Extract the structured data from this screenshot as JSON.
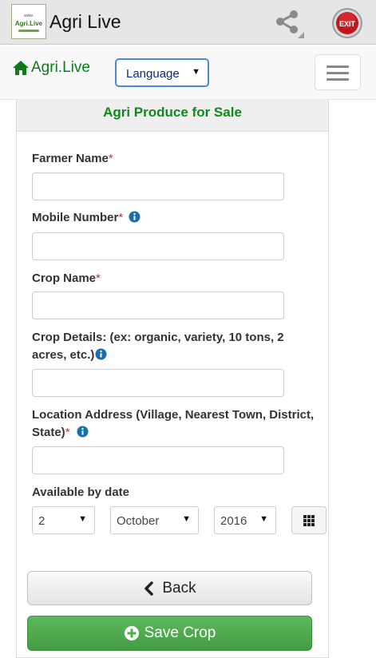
{
  "appbar": {
    "logo_top": "www.",
    "logo_text": "Agri.Live",
    "title": "Agri Live",
    "share_icon": "share-icon",
    "exit_label": "EXIT"
  },
  "navbar": {
    "brand": "Agri.Live",
    "home_icon": "home-icon",
    "language_select": "Language",
    "menu_icon": "hamburger-menu-icon"
  },
  "form": {
    "title": "Agri Produce for Sale",
    "farmer_name": {
      "label": "Farmer Name",
      "required": "*",
      "value": ""
    },
    "mobile_number": {
      "label": "Mobile Number",
      "required": "*",
      "value": ""
    },
    "crop_name": {
      "label": "Crop Name",
      "required": "*",
      "value": ""
    },
    "crop_details": {
      "label_line1": "Crop Details: (ex: organic, variety, 10 tons, 2",
      "label_line2": "acres, etc.)",
      "value": ""
    },
    "location": {
      "label_line1": "Location Address (Village, Nearest Town, District,",
      "label_line2": "State)",
      "required": "*",
      "value": ""
    },
    "available_by": {
      "label": "Available by date",
      "day": "2",
      "month": "October",
      "year": "2016"
    },
    "back_label": "Back",
    "save_label": "Save Crop"
  },
  "colors": {
    "brand_green": "#0d8a1d",
    "save_green": "#5cb85c",
    "info_blue": "#1a6fa8",
    "required_red": "#c9302c"
  }
}
